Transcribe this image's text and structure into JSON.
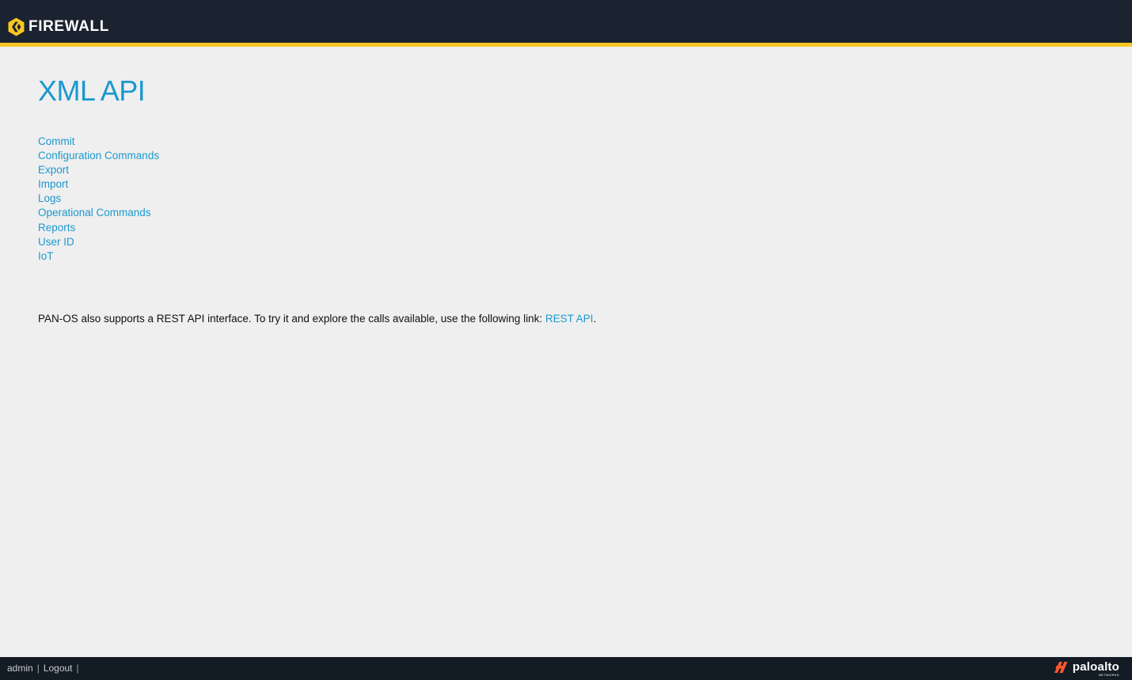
{
  "header": {
    "title": "FIREWALL",
    "accent_color": "#fac721",
    "background_color": "#1b2330",
    "logo_icon": "firewall-logo-icon"
  },
  "main": {
    "title": "XML API",
    "links": [
      {
        "label": "Commit"
      },
      {
        "label": "Configuration Commands"
      },
      {
        "label": "Export"
      },
      {
        "label": "Import"
      },
      {
        "label": "Logs"
      },
      {
        "label": "Operational Commands"
      },
      {
        "label": "Reports"
      },
      {
        "label": "User ID"
      },
      {
        "label": "IoT"
      }
    ],
    "rest_note": {
      "text": "PAN-OS also supports a REST API interface. To try it and explore the calls available, use the following link: ",
      "link_label": "REST API",
      "suffix": "."
    },
    "link_color": "#1c98cd"
  },
  "footer": {
    "user": "admin",
    "separator": "|",
    "logout_label": "Logout",
    "vendor_name": "paloalto",
    "vendor_sub": "NETWORKS",
    "vendor_icon": "paloalto-logo-icon",
    "vendor_icon_color": "#fa582d"
  }
}
